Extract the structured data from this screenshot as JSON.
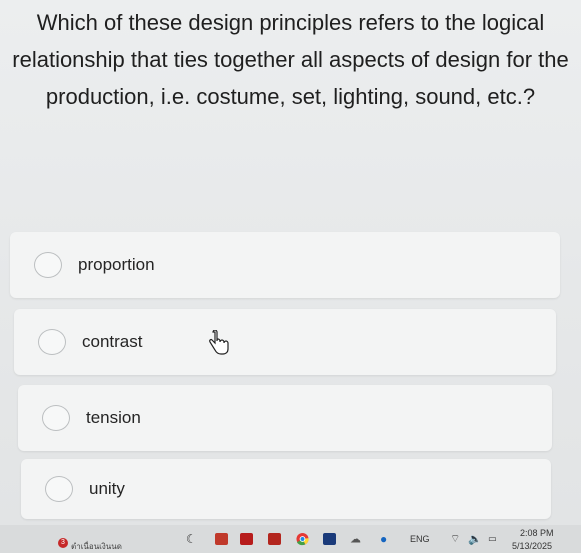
{
  "question": {
    "text": "Which of these design principles refers to the logical relationship that ties together all aspects of design for the production, i.e. costume, set, lighting, sound, etc.?"
  },
  "options": [
    {
      "label": "proportion"
    },
    {
      "label": "contrast"
    },
    {
      "label": "tension"
    },
    {
      "label": "unity"
    }
  ],
  "taskbar": {
    "notification_count": "3",
    "notification_text": "ตำเนื่อนเงินนด",
    "language": "ENG",
    "time": "2:08 PM",
    "date": "5/13/2025",
    "icons": [
      "c-icon",
      "app-icon",
      "app-icon",
      "app-icon",
      "chrome-icon",
      "app-icon",
      "cloud-icon",
      "info-icon",
      "wifi-icon",
      "speaker-icon",
      "battery-icon"
    ]
  },
  "colors": {
    "background": "#e7e9ea",
    "option_card": "#f3f4f4",
    "radio_border": "#bcbfc1"
  }
}
